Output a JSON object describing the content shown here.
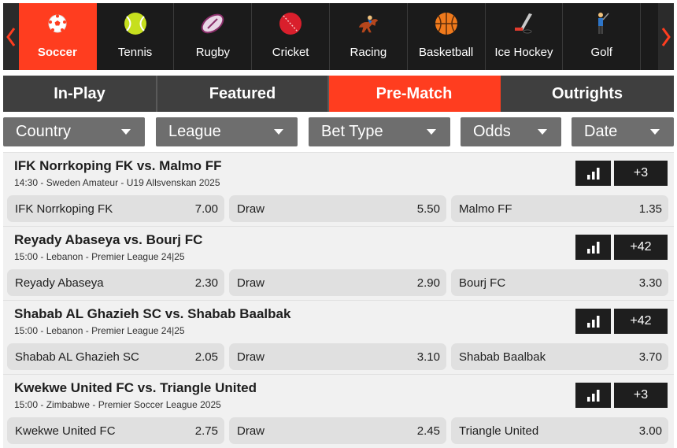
{
  "sports_nav": {
    "sports": [
      {
        "label": "Soccer",
        "icon": "soccer-ball-icon",
        "active": true
      },
      {
        "label": "Tennis",
        "icon": "tennis-ball-icon",
        "active": false
      },
      {
        "label": "Rugby",
        "icon": "rugby-ball-icon",
        "active": false
      },
      {
        "label": "Cricket",
        "icon": "cricket-ball-icon",
        "active": false
      },
      {
        "label": "Racing",
        "icon": "horse-racing-icon",
        "active": false
      },
      {
        "label": "Basketball",
        "icon": "basketball-icon",
        "active": false
      },
      {
        "label": "Ice Hockey",
        "icon": "ice-hockey-icon",
        "active": false
      },
      {
        "label": "Golf",
        "icon": "golfer-icon",
        "active": false
      }
    ]
  },
  "main_tabs": [
    {
      "label": "In-Play",
      "active": false
    },
    {
      "label": "Featured",
      "active": false
    },
    {
      "label": "Pre-Match",
      "active": true
    },
    {
      "label": "Outrights",
      "active": false
    }
  ],
  "filters": [
    {
      "label": "Country"
    },
    {
      "label": "League"
    },
    {
      "label": "Bet Type"
    },
    {
      "label": "Odds"
    },
    {
      "label": "Date"
    }
  ],
  "matches": [
    {
      "title": "IFK Norrkoping FK vs. Malmo FF",
      "subtitle": "14:30 - Sweden Amateur - U19 Allsvenskan 2025",
      "more_markets": "+3",
      "odds": [
        {
          "label": "IFK Norrkoping FK",
          "value": "7.00"
        },
        {
          "label": "Draw",
          "value": "5.50"
        },
        {
          "label": "Malmo FF",
          "value": "1.35"
        }
      ]
    },
    {
      "title": "Reyady Abaseya vs. Bourj FC",
      "subtitle": "15:00 - Lebanon - Premier League 24|25",
      "more_markets": "+42",
      "odds": [
        {
          "label": "Reyady Abaseya",
          "value": "2.30"
        },
        {
          "label": "Draw",
          "value": "2.90"
        },
        {
          "label": "Bourj FC",
          "value": "3.30"
        }
      ]
    },
    {
      "title": "Shabab AL Ghazieh SC vs. Shabab Baalbak",
      "subtitle": "15:00 - Lebanon - Premier League 24|25",
      "more_markets": "+42",
      "odds": [
        {
          "label": "Shabab AL Ghazieh SC",
          "value": "2.05"
        },
        {
          "label": "Draw",
          "value": "3.10"
        },
        {
          "label": "Shabab Baalbak",
          "value": "3.70"
        }
      ]
    },
    {
      "title": "Kwekwe United FC vs. Triangle United",
      "subtitle": "15:00 - Zimbabwe - Premier Soccer League 2025",
      "more_markets": "+3",
      "odds": [
        {
          "label": "Kwekwe United FC",
          "value": "2.75"
        },
        {
          "label": "Draw",
          "value": "2.45"
        },
        {
          "label": "Triangle United",
          "value": "3.00"
        }
      ]
    }
  ],
  "colors": {
    "accent": "#ff3d1f",
    "nav_bg": "#1b1b1b",
    "tab_bg": "#3f3f3f",
    "filter_bg": "#6e6e6e",
    "match_bg": "#f1f1f1",
    "odd_bg": "#e0e0e0"
  }
}
